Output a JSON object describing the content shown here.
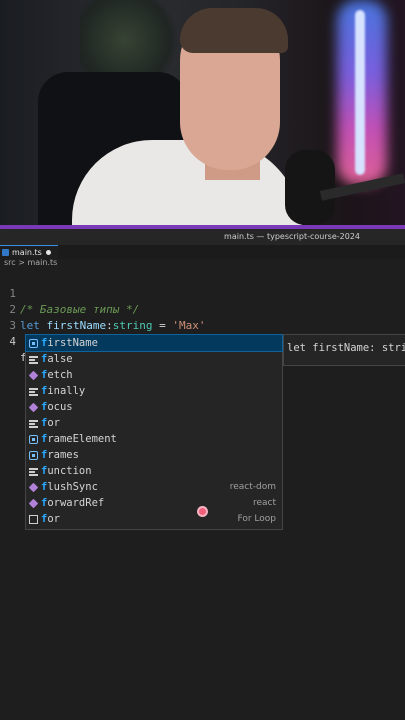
{
  "window_title": "main.ts — typescript-course-2024",
  "tab": {
    "label": "main.ts"
  },
  "breadcrumb": {
    "folder": "src",
    "separator": ">",
    "file": "main.ts"
  },
  "editor": {
    "lines": [
      {
        "number": "1",
        "comment": "/* Базовые типы */"
      },
      {
        "number": "2",
        "keyword": "let",
        "variable": "firstName",
        "colon": ":",
        "type": "string",
        "equals": " = ",
        "string": "'Max'"
      },
      {
        "number": "3"
      },
      {
        "number": "4",
        "typed": "f"
      }
    ]
  },
  "suggestions": [
    {
      "match": "f",
      "rest": "irstName",
      "icon": "variable-icon",
      "detail": "",
      "selected": true
    },
    {
      "match": "f",
      "rest": "alse",
      "icon": "keyword-icon",
      "detail": ""
    },
    {
      "match": "f",
      "rest": "etch",
      "icon": "function-icon",
      "detail": ""
    },
    {
      "match": "f",
      "rest": "inally",
      "icon": "keyword-icon",
      "detail": ""
    },
    {
      "match": "f",
      "rest": "ocus",
      "icon": "function-icon",
      "detail": ""
    },
    {
      "match": "f",
      "rest": "or",
      "icon": "keyword-icon",
      "detail": ""
    },
    {
      "match": "f",
      "rest": "rameElement",
      "icon": "variable-icon",
      "detail": ""
    },
    {
      "match": "f",
      "rest": "rames",
      "icon": "variable-icon",
      "detail": ""
    },
    {
      "match": "f",
      "rest": "unction",
      "icon": "keyword-icon",
      "detail": ""
    },
    {
      "match": "f",
      "rest": "lushSync",
      "icon": "function-icon",
      "detail": "react-dom"
    },
    {
      "match": "f",
      "rest": "orwardRef",
      "icon": "function-icon",
      "detail": "react"
    },
    {
      "match": "f",
      "rest": "or",
      "icon": "snippet-icon",
      "detail": "For Loop"
    }
  ],
  "suggestion_details": "let firstName: string"
}
